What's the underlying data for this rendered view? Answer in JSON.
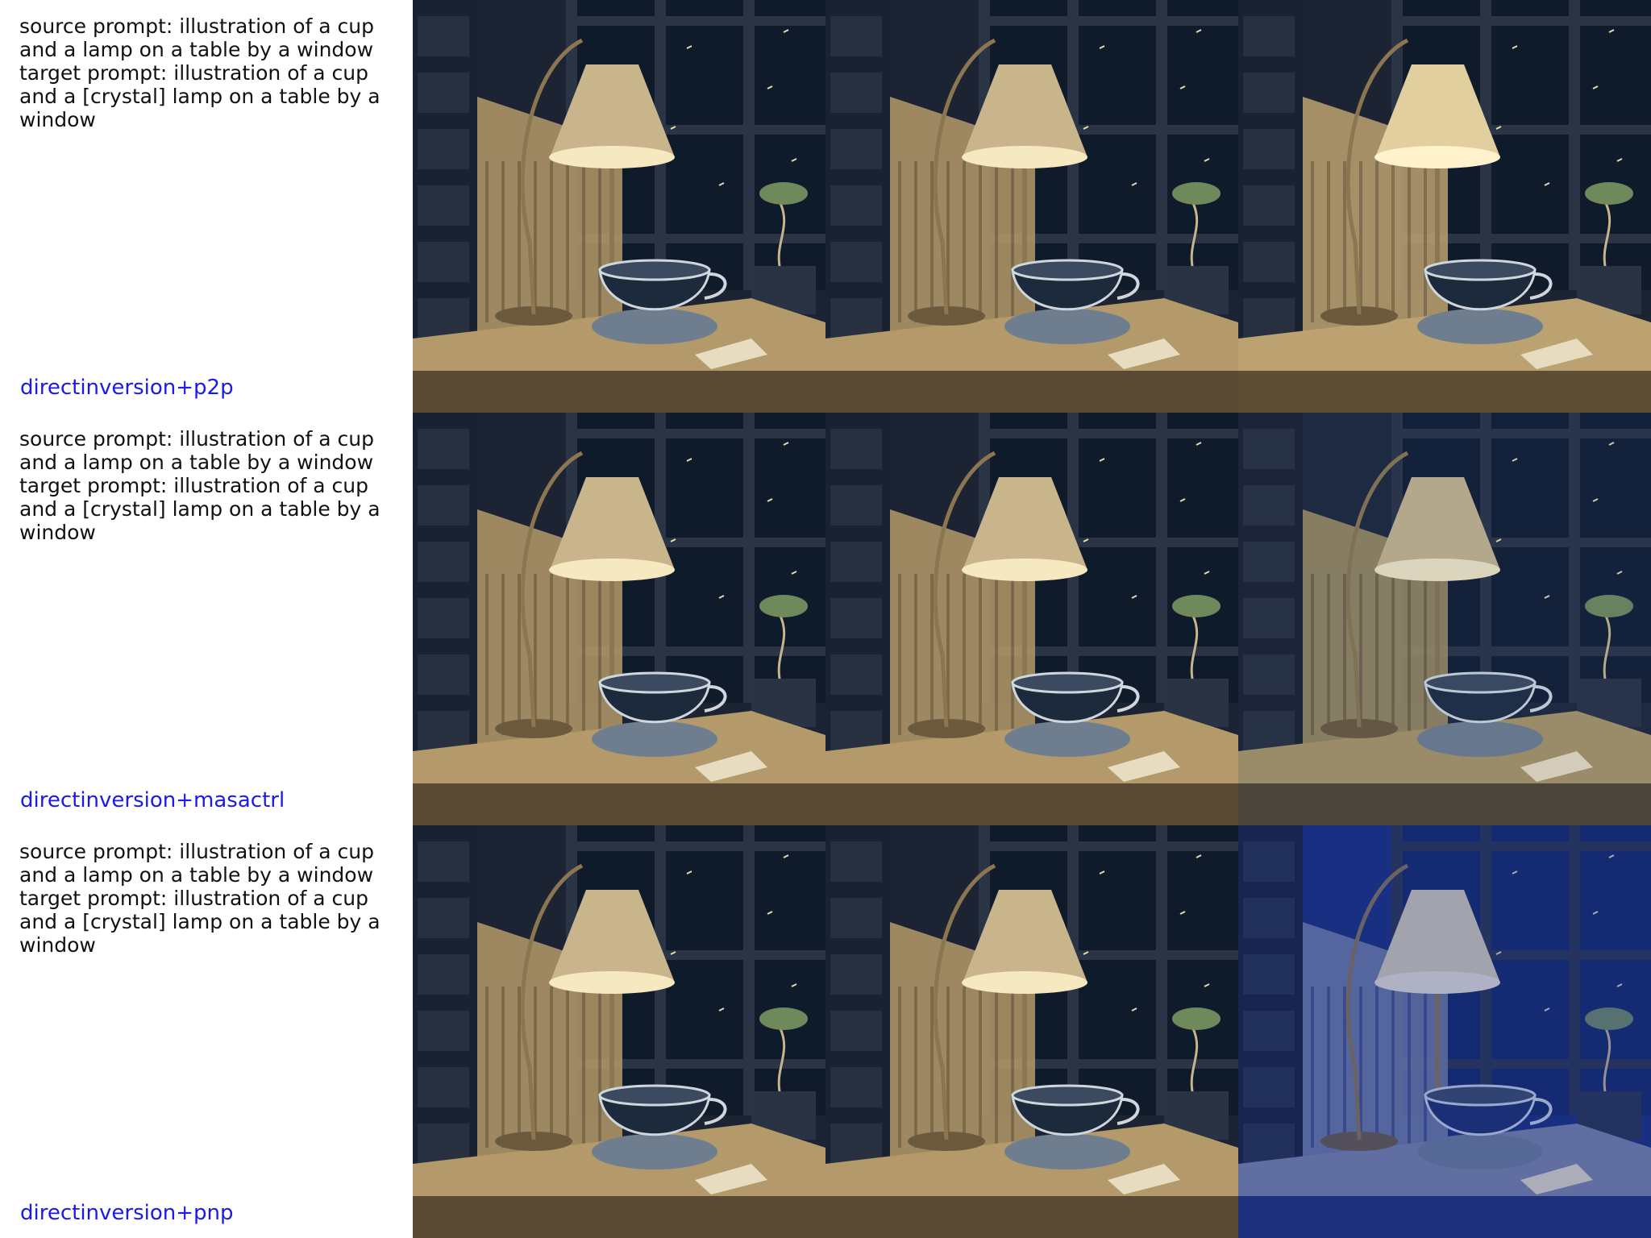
{
  "rows": [
    {
      "source_prompt": "source prompt: illustration of a cup and a lamp on a table by a window",
      "target_prompt": "target prompt: illustration of a cup and a [crystal] lamp on a table by a window",
      "method": "directinversion+p2p",
      "panels": [
        {
          "variant": "original"
        },
        {
          "variant": "original"
        },
        {
          "variant": "brighter-shade"
        }
      ]
    },
    {
      "source_prompt": "source prompt: illustration of a cup and a lamp on a table by a window",
      "target_prompt": "target prompt: illustration of a cup and a [crystal] lamp on a table by a window",
      "method": "directinversion+masactrl",
      "panels": [
        {
          "variant": "original"
        },
        {
          "variant": "original"
        },
        {
          "variant": "cool-tint"
        }
      ]
    },
    {
      "source_prompt": "source prompt: illustration of a cup and a lamp on a table by a window",
      "target_prompt": "target prompt: illustration of a cup and a [crystal] lamp on a table by a window",
      "method": "directinversion+pnp",
      "panels": [
        {
          "variant": "original"
        },
        {
          "variant": "original"
        },
        {
          "variant": "blue-crystal"
        }
      ]
    }
  ],
  "colors": {
    "method_label": "#1a1aee",
    "prompt_text": "#111111",
    "night_sky": "#0f1a2b",
    "wood_light": "#b49a6a",
    "lamp_glow": "#f6e9c2"
  }
}
